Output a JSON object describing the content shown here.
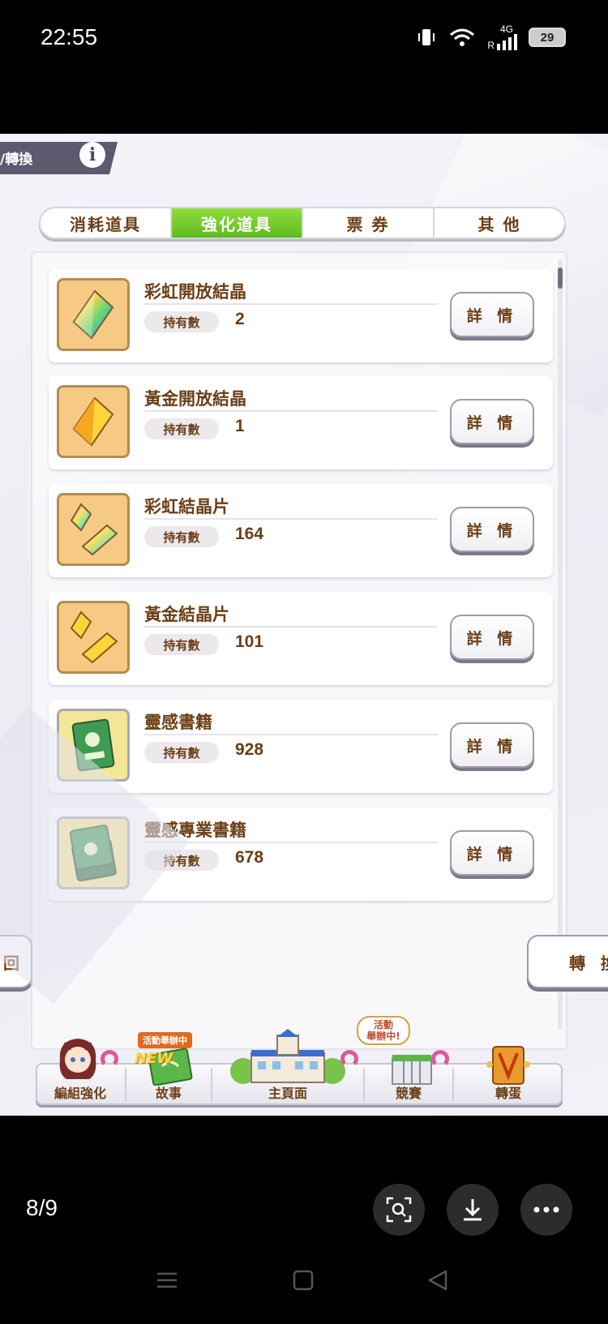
{
  "status_bar": {
    "time": "22:55",
    "network": "4G",
    "roaming": "R",
    "battery": "29",
    "icons": [
      "vibrate-icon",
      "wifi-icon",
      "signal-icon",
      "battery-icon"
    ]
  },
  "header": {
    "title": "/轉換",
    "info_label": "i"
  },
  "tabs": [
    {
      "label": "消耗道具",
      "active": false
    },
    {
      "label": "強化道具",
      "active": true
    },
    {
      "label": "票 券",
      "active": false
    },
    {
      "label": "其 他",
      "active": false
    }
  ],
  "items": [
    {
      "name": "彩虹開放結晶",
      "owned_label": "持有數",
      "owned": "2",
      "icon": "rainbow-crystal-icon",
      "detail_label": "詳 情"
    },
    {
      "name": "黃金開放結晶",
      "owned_label": "持有數",
      "owned": "1",
      "icon": "gold-crystal-icon",
      "detail_label": "詳 情"
    },
    {
      "name": "彩虹結晶片",
      "owned_label": "持有數",
      "owned": "164",
      "icon": "rainbow-shard-icon",
      "detail_label": "詳 情"
    },
    {
      "name": "黃金結晶片",
      "owned_label": "持有數",
      "owned": "101",
      "icon": "gold-shard-icon",
      "detail_label": "詳 情"
    },
    {
      "name": "靈感書籍",
      "owned_label": "持有數",
      "owned": "928",
      "icon": "inspiration-book-icon",
      "detail_label": "詳 情"
    },
    {
      "name": "靈感專業書籍",
      "owned_label": "持有數",
      "owned": "678",
      "icon": "pro-book-icon",
      "detail_label": "詳 情"
    }
  ],
  "actions": {
    "back_label": "回",
    "convert_label": "轉 換"
  },
  "bottom_nav": [
    {
      "label": "編組強化"
    },
    {
      "label": "故事",
      "badge": "活動舉辦中",
      "new": "NEW"
    },
    {
      "label": "主頁面"
    },
    {
      "label": "競賽",
      "bubble": "活動\n舉辦中!"
    },
    {
      "label": "轉蛋"
    }
  ],
  "viewer": {
    "page_counter": "8/9"
  },
  "colors": {
    "accent_green": "#6cc62a",
    "text_brown": "#6b3e15",
    "pink_ring": "#e0579e"
  }
}
